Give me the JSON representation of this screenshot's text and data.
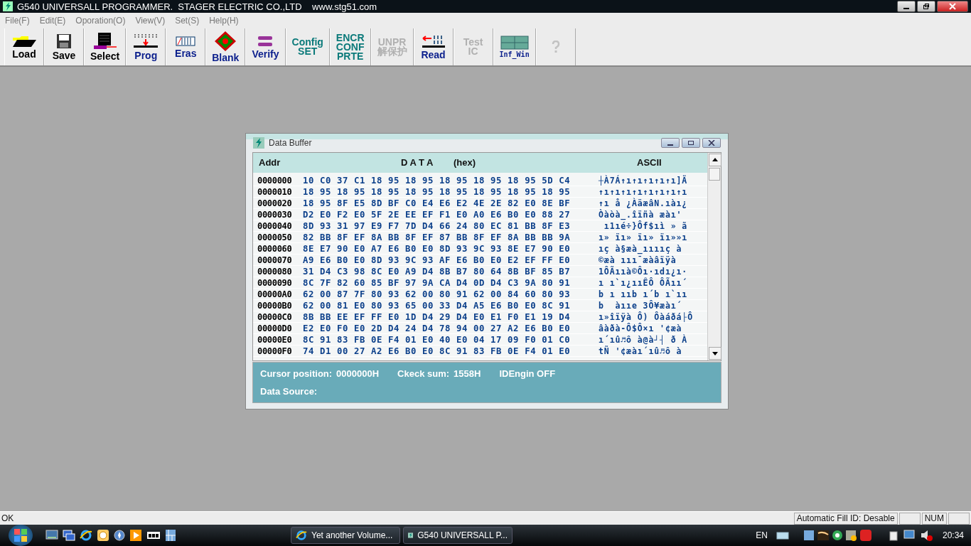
{
  "window": {
    "title": "G540 UNIVERSALL PROGRAMMER.  STAGER ELECTRIC CO.,LTD    www.stg51.com"
  },
  "menu": [
    "File(F)",
    "Edit(E)",
    "Oporation(O)",
    "View(V)",
    "Set(S)",
    "Help(H)"
  ],
  "toolbar": [
    {
      "kind": "folder",
      "lines": [
        "Load"
      ],
      "color": "#000000",
      "disabled": false
    },
    {
      "kind": "floppy",
      "lines": [
        "Save"
      ],
      "color": "#000000",
      "disabled": false
    },
    {
      "kind": "chip",
      "lines": [
        "Select"
      ],
      "color": "#000000",
      "disabled": false
    },
    {
      "kind": "prog",
      "lines": [
        "Prog"
      ],
      "color": "#0a1e8c",
      "disabled": false
    },
    {
      "kind": "eras",
      "lines": [
        "Eras"
      ],
      "color": "#0a1e8c",
      "disabled": false
    },
    {
      "kind": "blank",
      "lines": [
        "Blank"
      ],
      "color": "#0a1e8c",
      "disabled": false
    },
    {
      "kind": "verify",
      "lines": [
        "Verify"
      ],
      "color": "#0a1e8c",
      "disabled": false
    },
    {
      "kind": "text",
      "lines": [
        "Config",
        "SET"
      ],
      "color": "#0b7a7a",
      "disabled": false
    },
    {
      "kind": "text",
      "lines": [
        "ENCR",
        "CONF",
        "PRTE"
      ],
      "color": "#0b7a7a",
      "disabled": false
    },
    {
      "kind": "text",
      "lines": [
        "UNPR",
        "解保护"
      ],
      "disabled": true
    },
    {
      "kind": "read",
      "lines": [
        "Read"
      ],
      "color": "#0a1e8c",
      "disabled": false
    },
    {
      "kind": "text",
      "lines": [
        "Test",
        "IC"
      ],
      "disabled": true
    },
    {
      "kind": "window",
      "lines": [
        "Inf_Win"
      ],
      "color": "#0a1e8c",
      "disabled": false
    },
    {
      "kind": "question",
      "disabled": true
    }
  ],
  "data_buffer": {
    "title": "Data Buffer",
    "header": {
      "addr": "Addr",
      "data": "D A T A",
      "hex": "(hex)",
      "ascii": "ASCII"
    },
    "rows": [
      {
        "addr": "0000000",
        "hex": "10 C0 37 C1 18 95 18 95 18 95 18 95 18 95 5D C4",
        "ascii": "┼À7Á↑ı↑ı↑ı↑ı↑ı]Ä"
      },
      {
        "addr": "0000010",
        "hex": "18 95 18 95 18 95 18 95 18 95 18 95 18 95 18 95",
        "ascii": "↑ı↑ı↑ı↑ı↑ı↑ı↑ı↑ı"
      },
      {
        "addr": "0000020",
        "hex": "18 95 8F E5 8D BF C0 E4 E6 E2 4E 2E 82 E0 8E BF",
        "ascii": "↑ı å ¿ÀäæâN.ıàı¿"
      },
      {
        "addr": "0000030",
        "hex": "D2 E0 F2 E0 5F 2E EE EF F1 E0 A0 E6 B0 E0 88 27",
        "ascii": "Òàòà_.îïñà æàı'"
      },
      {
        "addr": "0000040",
        "hex": "8D 93 31 97 E9 F7 7D D4 66 24 80 EC 81 BB 8F E3",
        "ascii": " ı1ıé÷}Ôf$ıì » ã"
      },
      {
        "addr": "0000050",
        "hex": "82 BB 8F EF 8A BB 8F EF 87 BB 8F EF 8A BB BB 9A",
        "ascii": "ı» ïı» ïı» ïı»»ı"
      },
      {
        "addr": "0000060",
        "hex": "8E E7 90 E0 A7 E6 B0 E0 8D 93 9C 93 8E E7 90 E0",
        "ascii": "ıç à§æà_ııııç à"
      },
      {
        "addr": "0000070",
        "hex": "A9 E6 B0 E0 8D 93 9C 93 AF E6 B0 E0 E2 EF FF E0",
        "ascii": "©æà ııı¯æàâïÿà"
      },
      {
        "addr": "0000080",
        "hex": "31 D4 C3 98 8C E0 A9 D4 8B B7 80 64 8B BF 85 B7",
        "ascii": "1ÔÃııà©Ôı·ıdı¿ı·"
      },
      {
        "addr": "0000090",
        "hex": "8C 7F 82 60 85 BF 97 9A CA D4 0D D4 C3 9A 80 91",
        "ascii": "ı ı`ı¿ııÊÔ ÔÃıı´"
      },
      {
        "addr": "00000A0",
        "hex": "62 00 87 7F 80 93 62 00 80 91 62 00 84 60 80 93",
        "ascii": "b ı ııb ı´b ı`ıı"
      },
      {
        "addr": "00000B0",
        "hex": "62 00 81 E0 80 93 65 00 33 D4 A5 E6 B0 E0 8C 91",
        "ascii": "b  àııe 3Ô¥æàı´"
      },
      {
        "addr": "00000C0",
        "hex": "8B BB EE EF FF E0 1D D4 29 D4 E0 E1 F0 E1 19 D4",
        "ascii": "ı»îïÿà Ô) Ôàáðá├Ô"
      },
      {
        "addr": "00000D0",
        "hex": "E2 E0 F0 E0 2D D4 24 D4 78 94 00 27 A2 E6 B0 E0",
        "ascii": "âàðà-Ô$Ô×ı '¢æà"
      },
      {
        "addr": "00000E0",
        "hex": "8C 91 83 FB 0E F4 01 E0 40 E0 04 17 09 F0 01 C0",
        "ascii": "ı´ıû♬ô à@à┘┤ ð À"
      },
      {
        "addr": "00000F0",
        "hex": "74 D1 00 27 A2 E6 B0 E0 8C 91 83 FB 0E F4 01 E0",
        "ascii": "tÑ '¢æàı´ıû♬ô à"
      }
    ],
    "info": [
      {
        "label": "Cursor position:",
        "value": "0000000H"
      },
      {
        "label": "Ckeck sum:",
        "value": "1558H"
      },
      {
        "label": "IDEngin OFF"
      }
    ],
    "data_source": "Data Source:"
  },
  "status_bar": {
    "message": "OK",
    "panes": [
      "Automatic Fill ID: Desable",
      "NUM"
    ]
  },
  "taskbar": {
    "tasks": [
      {
        "label": "Yet another Volume...",
        "kind": "ie"
      },
      {
        "label": "G540 UNIVERSALL P...",
        "kind": "app"
      }
    ],
    "language": "EN",
    "clock": "20:34"
  }
}
